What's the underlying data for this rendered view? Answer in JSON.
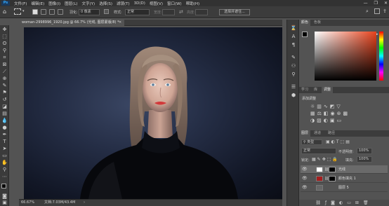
{
  "menubar": {
    "logo": "Ps",
    "items": [
      "文件(F)",
      "编辑(E)",
      "图像(I)",
      "图层(L)",
      "文字(Y)",
      "选择(S)",
      "滤镜(T)",
      "3D(D)",
      "视图(V)",
      "窗口(W)",
      "帮助(H)"
    ],
    "minimize": "—",
    "maximize": "❐",
    "close": "✕"
  },
  "options": {
    "feather_label": "羽化:",
    "feather_value": "0 像素",
    "style_label": "样式:",
    "style_value": "正常",
    "width_label": "宽度:",
    "height_label": "高度:",
    "select_mask": "选择并遮住..."
  },
  "document": {
    "tab_title": "woman-2998996_1920.jpg @ 66.7% (光线, 图层蒙版/8) *",
    "zoom": "66.67%",
    "doc_info": "文档:7.03M/43.4M"
  },
  "color_panel": {
    "tabs": [
      "颜色",
      "色板"
    ],
    "hue_color": "#e8421c"
  },
  "adjust_panel": {
    "tabs": [
      "学习",
      "库",
      "调整"
    ],
    "title": "添加调整"
  },
  "layers_panel": {
    "tabs": [
      "图层",
      "通道",
      "路径"
    ],
    "filter_kind": "类型",
    "blend_mode": "正常",
    "opacity_label": "不透明度:",
    "opacity_value": "100%",
    "lock_label": "锁定:",
    "fill_label": "填充:",
    "fill_value": "100%",
    "layers": [
      {
        "name": "光线",
        "selected": true,
        "thumb": "#ffffff",
        "mask": "#000000"
      },
      {
        "name": "颜色填充 1",
        "selected": false,
        "thumb": "#a51e1e",
        "mask": "#000000"
      },
      {
        "name": "图层 5",
        "selected": false,
        "thumb": "#666666",
        "mask": ""
      }
    ]
  }
}
